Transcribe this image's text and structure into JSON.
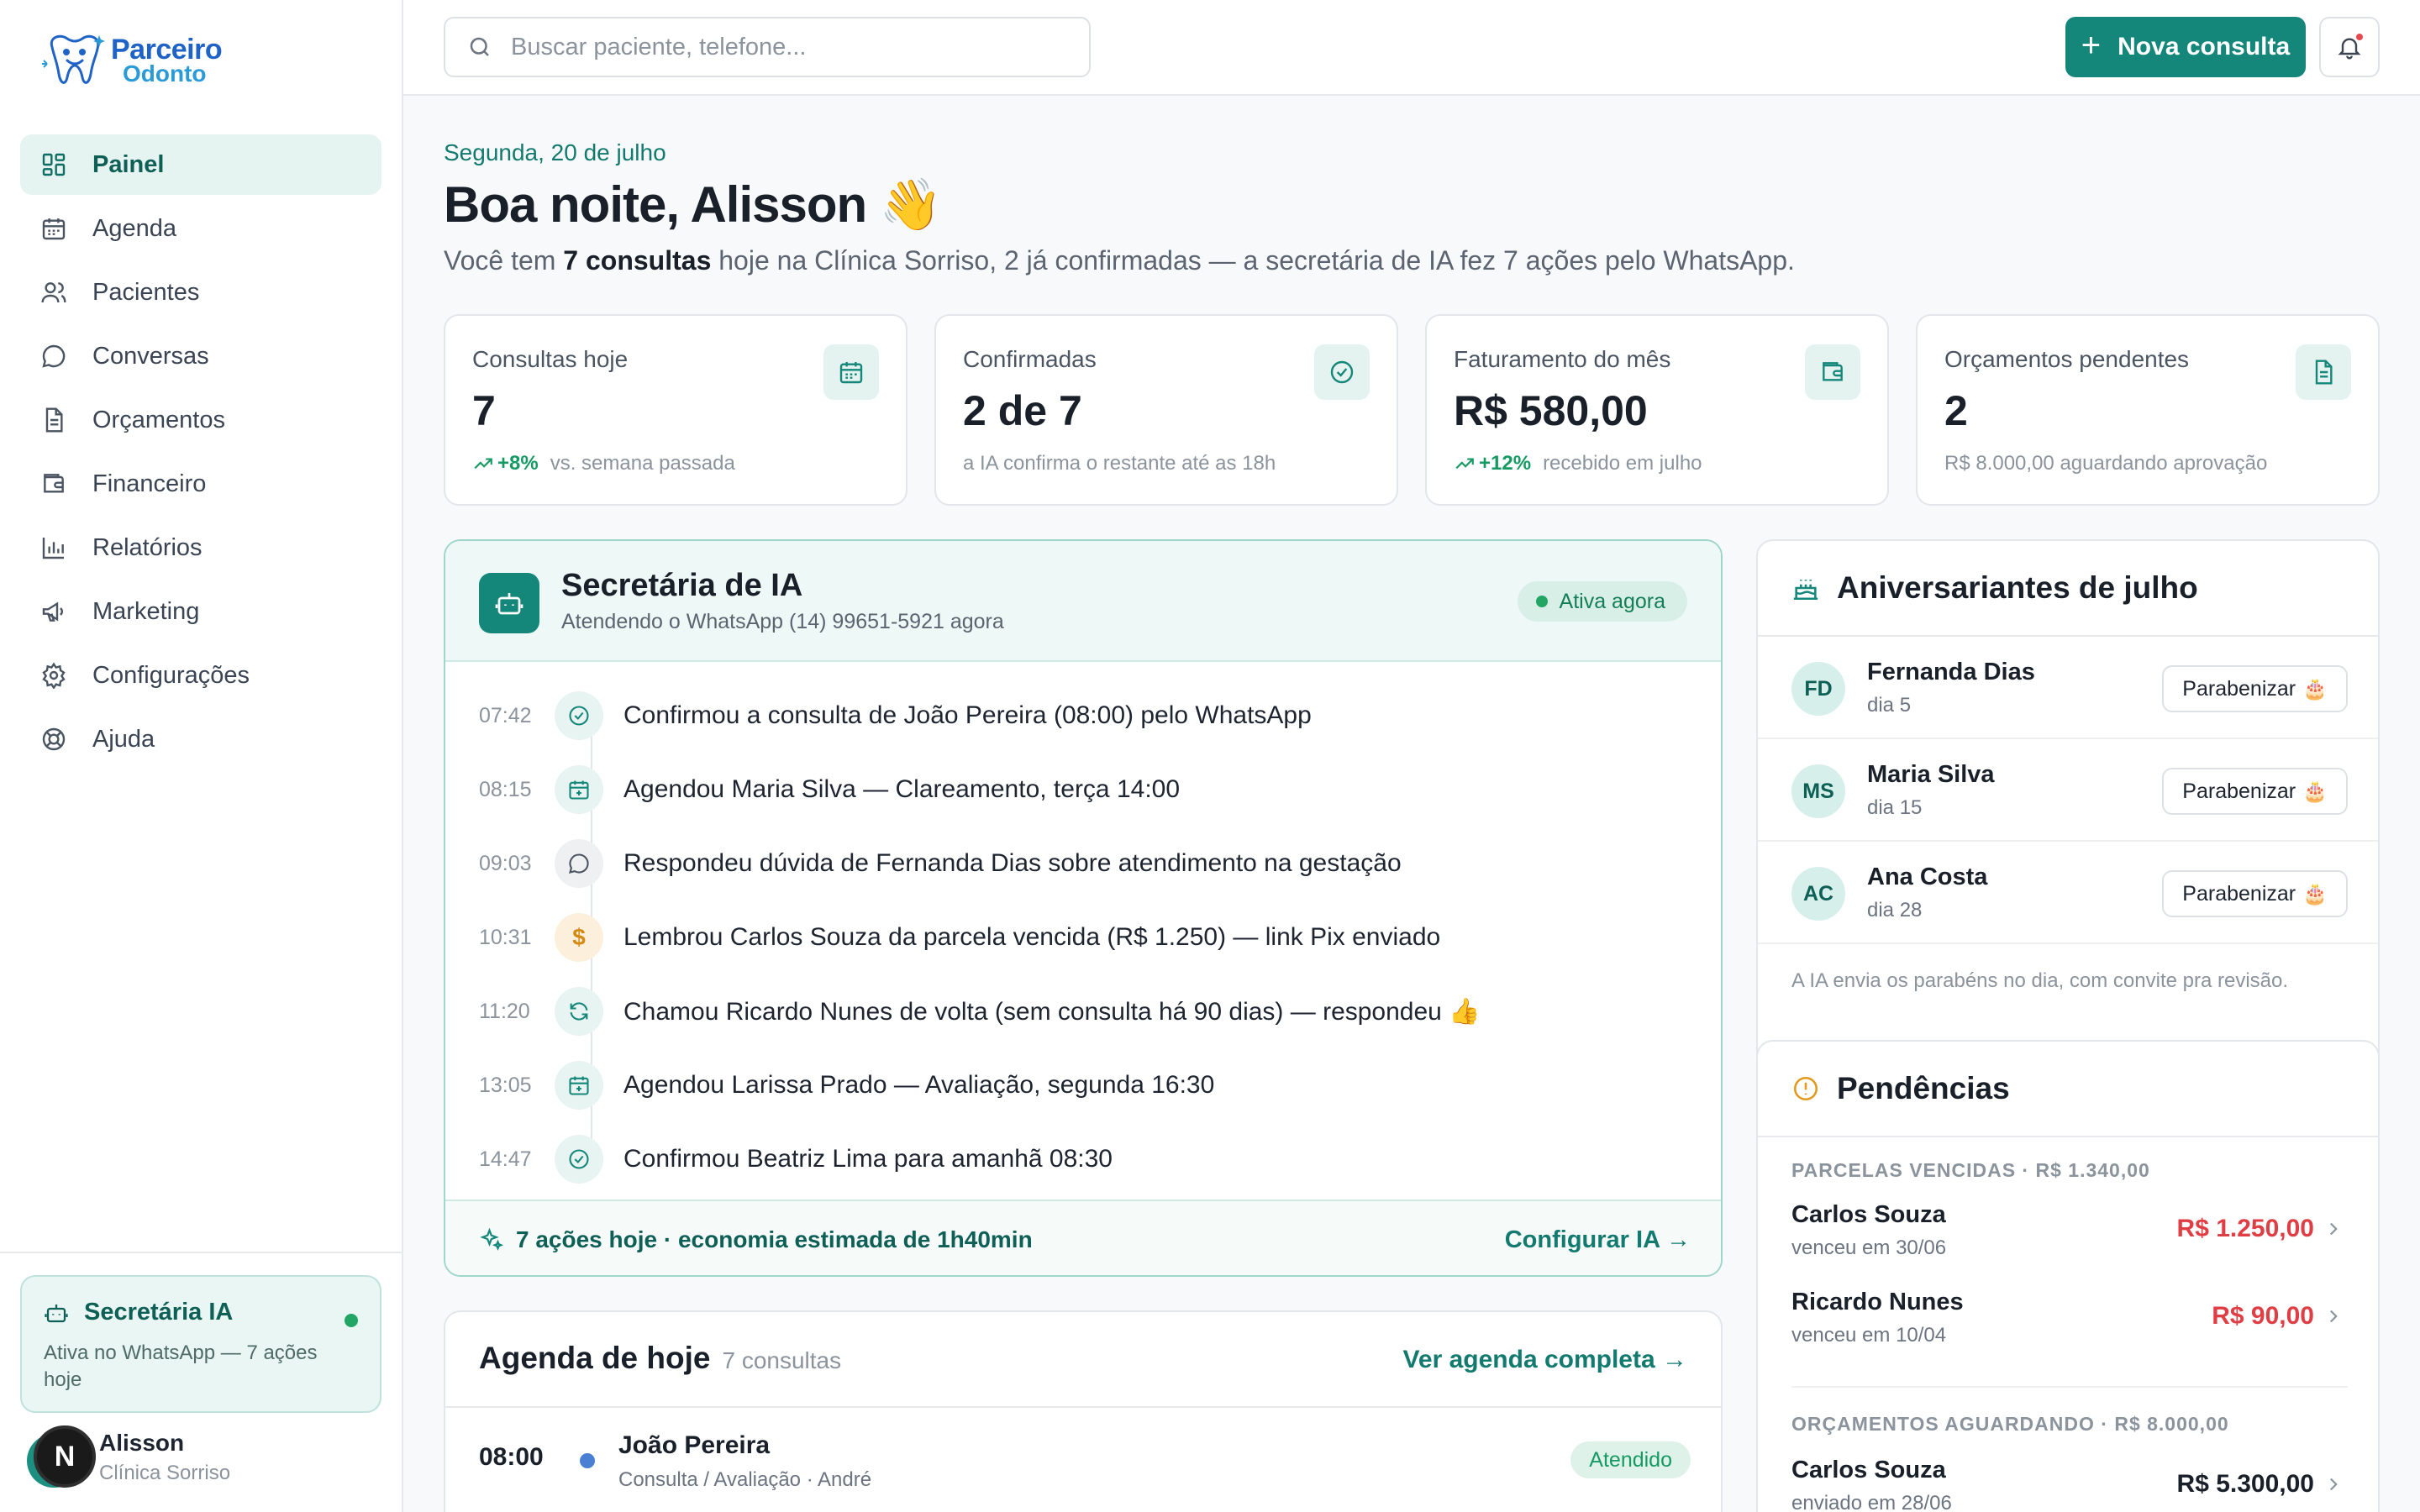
{
  "brand": {
    "line1": "Parceiro",
    "line2": "Odonto"
  },
  "nav": [
    {
      "label": "Painel",
      "icon": "dashboard-icon",
      "active": true
    },
    {
      "label": "Agenda",
      "icon": "calendar-icon"
    },
    {
      "label": "Pacientes",
      "icon": "users-icon"
    },
    {
      "label": "Conversas",
      "icon": "chat-icon"
    },
    {
      "label": "Orçamentos",
      "icon": "document-icon"
    },
    {
      "label": "Financeiro",
      "icon": "wallet-icon"
    },
    {
      "label": "Relatórios",
      "icon": "bar-chart-icon"
    },
    {
      "label": "Marketing",
      "icon": "megaphone-icon"
    },
    {
      "label": "Configurações",
      "icon": "gear-icon"
    },
    {
      "label": "Ajuda",
      "icon": "lifebuoy-icon"
    }
  ],
  "sidebar_ia": {
    "title": "Secretária IA",
    "subtitle": "Ativa no WhatsApp — 7 ações hoje"
  },
  "user": {
    "initial": "N",
    "name": "Alisson",
    "clinic": "Clínica Sorriso"
  },
  "topbar": {
    "search_placeholder": "Buscar paciente, telefone...",
    "new_button": "Nova consulta"
  },
  "header": {
    "date": "Segunda, 20 de julho",
    "greeting": "Boa noite, Alisson 👋",
    "intro_pre": "Você tem ",
    "intro_bold": "7 consultas",
    "intro_post": " hoje na Clínica Sorriso, 2 já confirmadas — a secretária de IA fez 7 ações pelo WhatsApp."
  },
  "stats": [
    {
      "label": "Consultas hoje",
      "value": "7",
      "trend": "+8%",
      "foot": "vs. semana passada",
      "icon": "calendar-icon"
    },
    {
      "label": "Confirmadas",
      "value": "2 de 7",
      "trend": "",
      "foot": "a IA confirma o restante até as 18h",
      "icon": "check-circle-icon"
    },
    {
      "label": "Faturamento do mês",
      "value": "R$ 580,00",
      "trend": "+12%",
      "foot": "recebido em julho",
      "icon": "wallet-icon"
    },
    {
      "label": "Orçamentos pendentes",
      "value": "2",
      "trend": "",
      "foot": "R$ 8.000,00 aguardando aprovação",
      "icon": "document-icon"
    }
  ],
  "ia_panel": {
    "title": "Secretária de IA",
    "subtitle": "Atendendo o WhatsApp (14) 99651-5921 agora",
    "status": "Ativa agora",
    "events": [
      {
        "time": "07:42",
        "icon": "check-circle-icon",
        "text": "Confirmou a consulta de João Pereira (08:00) pelo WhatsApp"
      },
      {
        "time": "08:15",
        "icon": "calendar-plus-icon",
        "text": "Agendou Maria Silva — Clareamento, terça 14:00"
      },
      {
        "time": "09:03",
        "icon": "chat-icon",
        "text": "Respondeu dúvida de Fernanda Dias sobre atendimento na gestação"
      },
      {
        "time": "10:31",
        "icon": "dollar-icon",
        "text": "Lembrou Carlos Souza da parcela vencida (R$ 1.250) — link Pix enviado"
      },
      {
        "time": "11:20",
        "icon": "refresh-icon",
        "text": "Chamou Ricardo Nunes de volta (sem consulta há 90 dias) — respondeu 👍"
      },
      {
        "time": "13:05",
        "icon": "calendar-plus-icon",
        "text": "Agendou Larissa Prado — Avaliação, segunda 16:30"
      },
      {
        "time": "14:47",
        "icon": "check-circle-icon",
        "text": "Confirmou Beatriz Lima para amanhã 08:30"
      }
    ],
    "footer": "7 ações hoje · economia estimada de 1h40min",
    "footer_link": "Configurar IA →"
  },
  "agenda": {
    "title": "Agenda de hoje",
    "count": "7 consultas",
    "link": "Ver agenda completa →",
    "rows": [
      {
        "time": "08:00",
        "name": "João Pereira",
        "detail": "Consulta / Avaliação · André",
        "status": "Atendido",
        "dot_color": "#4a7fd4"
      }
    ]
  },
  "birthdays": {
    "title": "Aniversariantes de julho",
    "items": [
      {
        "initials": "FD",
        "name": "Fernanda Dias",
        "day": "dia 5",
        "button": "Parabenizar"
      },
      {
        "initials": "MS",
        "name": "Maria Silva",
        "day": "dia 15",
        "button": "Parabenizar"
      },
      {
        "initials": "AC",
        "name": "Ana Costa",
        "day": "dia 28",
        "button": "Parabenizar"
      }
    ],
    "footer": "A IA envia os parabéns no dia, com convite pra revisão."
  },
  "pending": {
    "title": "Pendências",
    "sections": [
      {
        "header": "PARCELAS VENCIDAS · R$ 1.340,00",
        "items": [
          {
            "name": "Carlos Souza",
            "sub": "venceu em 30/06",
            "amount": "R$ 1.250,00"
          },
          {
            "name": "Ricardo Nunes",
            "sub": "venceu em 10/04",
            "amount": "R$ 90,00"
          }
        ]
      },
      {
        "header": "ORÇAMENTOS AGUARDANDO · R$ 8.000,00",
        "items": [
          {
            "name": "Carlos Souza",
            "sub": "enviado em 28/06",
            "amount": "R$ 5.300,00"
          }
        ]
      }
    ]
  },
  "colors": {
    "accent": "#15877a",
    "accent_light": "#e6f4f1",
    "danger": "#e03e45",
    "success": "#169a63"
  }
}
